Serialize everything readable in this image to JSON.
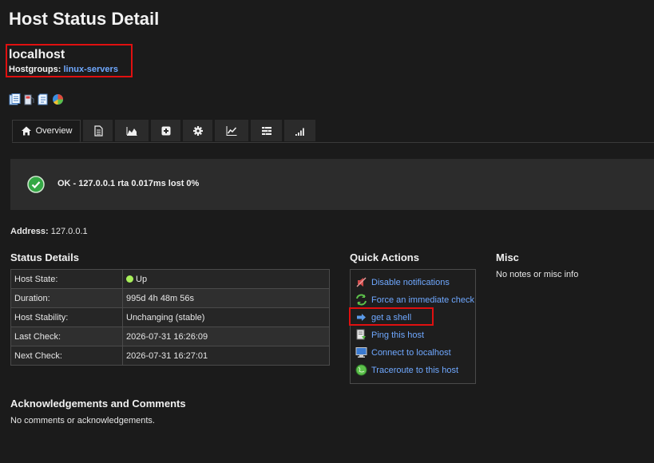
{
  "page": {
    "title": "Host Status Detail"
  },
  "host": {
    "name": "localhost",
    "hostgroups_label": "Hostgroups:",
    "hostgroups_value": "linux-servers"
  },
  "header_icons": [
    "notes-document-icon",
    "gas-pump-icon",
    "report-icon",
    "pie-chart-icon"
  ],
  "tabs": [
    {
      "icon": "home-icon",
      "label": "Overview",
      "active": true
    },
    {
      "icon": "document-icon",
      "label": ""
    },
    {
      "icon": "area-chart-icon",
      "label": ""
    },
    {
      "icon": "plus-square-icon",
      "label": ""
    },
    {
      "icon": "gear-icon",
      "label": ""
    },
    {
      "icon": "line-chart-icon",
      "label": ""
    },
    {
      "icon": "list-icon",
      "label": ""
    },
    {
      "icon": "signal-bars-icon",
      "label": ""
    }
  ],
  "status": {
    "text": "OK - 127.0.0.1 rta 0.017ms lost 0%",
    "icon": "check-circle-icon",
    "color": "#34a845"
  },
  "address": {
    "label": "Address:",
    "value": "127.0.0.1"
  },
  "status_details": {
    "title": "Status Details",
    "rows": [
      {
        "label": "Host State:",
        "value": "Up"
      },
      {
        "label": "Duration:",
        "value": "995d 4h 48m 56s"
      },
      {
        "label": "Host Stability:",
        "value": "Unchanging (stable)"
      },
      {
        "label": "Last Check:",
        "value": "2026-07-31 16:26:09"
      },
      {
        "label": "Next Check:",
        "value": "2026-07-31 16:27:01"
      }
    ]
  },
  "quick_actions": {
    "title": "Quick Actions",
    "items": [
      {
        "icon": "notifications-off-icon",
        "label": "Disable notifications"
      },
      {
        "icon": "refresh-icon",
        "label": "Force an immediate check"
      },
      {
        "icon": "arrow-right-icon",
        "label": "get a shell"
      },
      {
        "icon": "ping-icon",
        "label": "Ping this host"
      },
      {
        "icon": "monitor-icon",
        "label": "Connect to localhost"
      },
      {
        "icon": "globe-icon",
        "label": "Traceroute to this host"
      }
    ]
  },
  "misc": {
    "title": "Misc",
    "text": "No notes or misc info"
  },
  "acknowledgements": {
    "title": "Acknowledgements and Comments",
    "text": "No comments or acknowledgements."
  },
  "colors": {
    "link": "#6fa8ff",
    "highlight": "#e01010",
    "up": "#a8f05a"
  }
}
